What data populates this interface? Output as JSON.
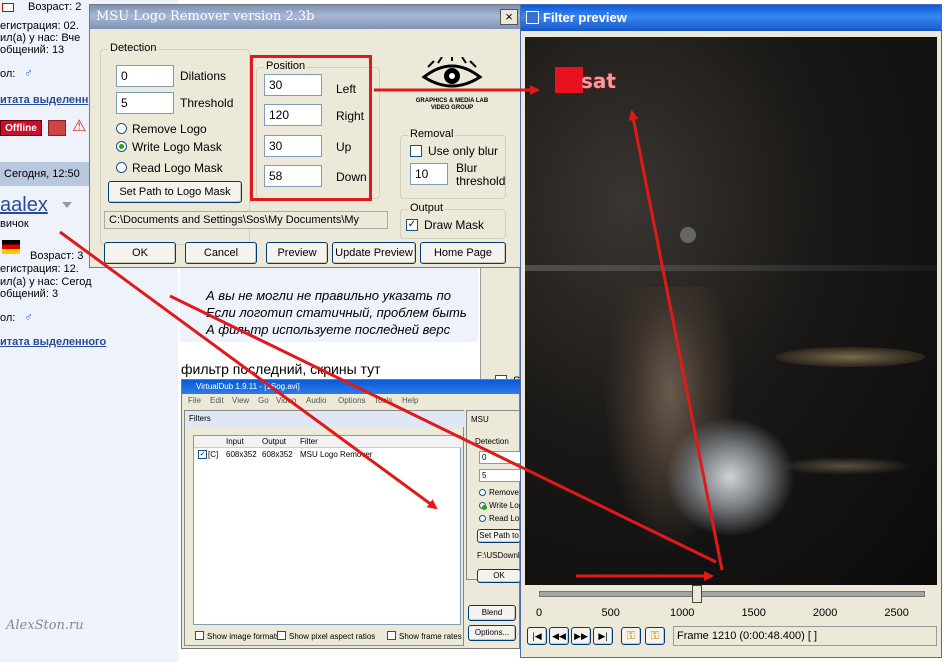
{
  "forum": {
    "user1": {
      "age_label": "Возраст: 2",
      "reg_label": "егистрация: 02.",
      "last_label": "ил(а) у нас: Вче",
      "posts_label": "общений: 13",
      "gender_label": "ол:",
      "quote_link": "итата выделенн",
      "offline_badge": "Offline"
    },
    "date_band": "Сегодня, 12:50",
    "user2": {
      "name": "aalex",
      "rank": "вичок",
      "age_label": "Возраст: 3",
      "reg_label": "егистрация: 12.",
      "last_label": "ил(а) у нас: Сегод",
      "posts_label": "общений: 3",
      "gender_label": "ол:",
      "quote_link": "итата выделенного"
    },
    "post_lines": [
      "А вы не могли не правильно указать по",
      "Если логотип статичный, проблем быть",
      "А фильтр используете последней верс"
    ],
    "reply_text": "фильтр последний, скрины тут"
  },
  "msu": {
    "title": "MSU Logo Remover version 2.3b",
    "close": "×",
    "detection_title": "Detection",
    "dilations_value": "0",
    "dilations_label": "Dilations",
    "threshold_value": "5",
    "threshold_label": "Threshold",
    "radio_remove": "Remove Logo",
    "radio_write": "Write Logo Mask",
    "radio_read": "Read Logo Mask",
    "set_path": "Set Path to Logo Mask",
    "path_value": "C:\\Documents and Settings\\Sos\\My Documents\\My",
    "position_title": "Position",
    "left_value": "30",
    "left_label": "Left",
    "right_value": "120",
    "right_label": "Right",
    "up_value": "30",
    "up_label": "Up",
    "down_value": "58",
    "down_label": "Down",
    "logo_text1": "GRAPHICS & MEDIA LAB",
    "logo_text2": "VIDEO GROUP",
    "removal_title": "Removal",
    "use_only_blur": "Use only blur",
    "blur_value": "10",
    "blur_label1": "Blur",
    "blur_label2": "threshold",
    "output_title": "Output",
    "draw_mask": "Draw Mask",
    "btn_ok": "OK",
    "btn_cancel": "Cancel",
    "btn_preview": "Preview",
    "btn_update": "Update Preview",
    "btn_home": "Home Page"
  },
  "preview": {
    "title": "Filter preview",
    "logo_text": "sat",
    "ticks": [
      "0",
      "500",
      "1000",
      "1500",
      "2000",
      "2500"
    ],
    "frame_status": "Frame 1210 (0:00:48.400) [ ]",
    "slider_fraction": 0.41
  },
  "vdub": {
    "title": "VirtualDub 1.9.11 - [1Sog.avi]",
    "menu": [
      "File",
      "Edit",
      "View",
      "Go",
      "Video",
      "Audio",
      "Options",
      "Tools",
      "Help"
    ],
    "filters_title": "Filters",
    "col_input": "Input",
    "col_output": "Output",
    "col_filter": "Filter",
    "row_tag": "[C]",
    "row_input": "608x352",
    "row_output": "608x352",
    "row_filter": "MSU Logo Remover",
    "check_formats": "Show image formats",
    "check_aspect": "Show pixel aspect ratios",
    "check_rates": "Show frame rates",
    "btn_blend": "Blend",
    "btn_options": "Options...",
    "inner_title": "MSU",
    "inner_detection": "Detection",
    "inner_v1": "0",
    "inner_v2": "5",
    "inner_r1": "Remove",
    "inner_r2": "Write Logo",
    "inner_r3": "Read Lo",
    "inner_setpath": "Set Path to",
    "inner_path": "F:\\USDownloa",
    "inner_ok": "OK"
  },
  "behind_checkbox_label": "S",
  "signature": "AlexSton.ru"
}
